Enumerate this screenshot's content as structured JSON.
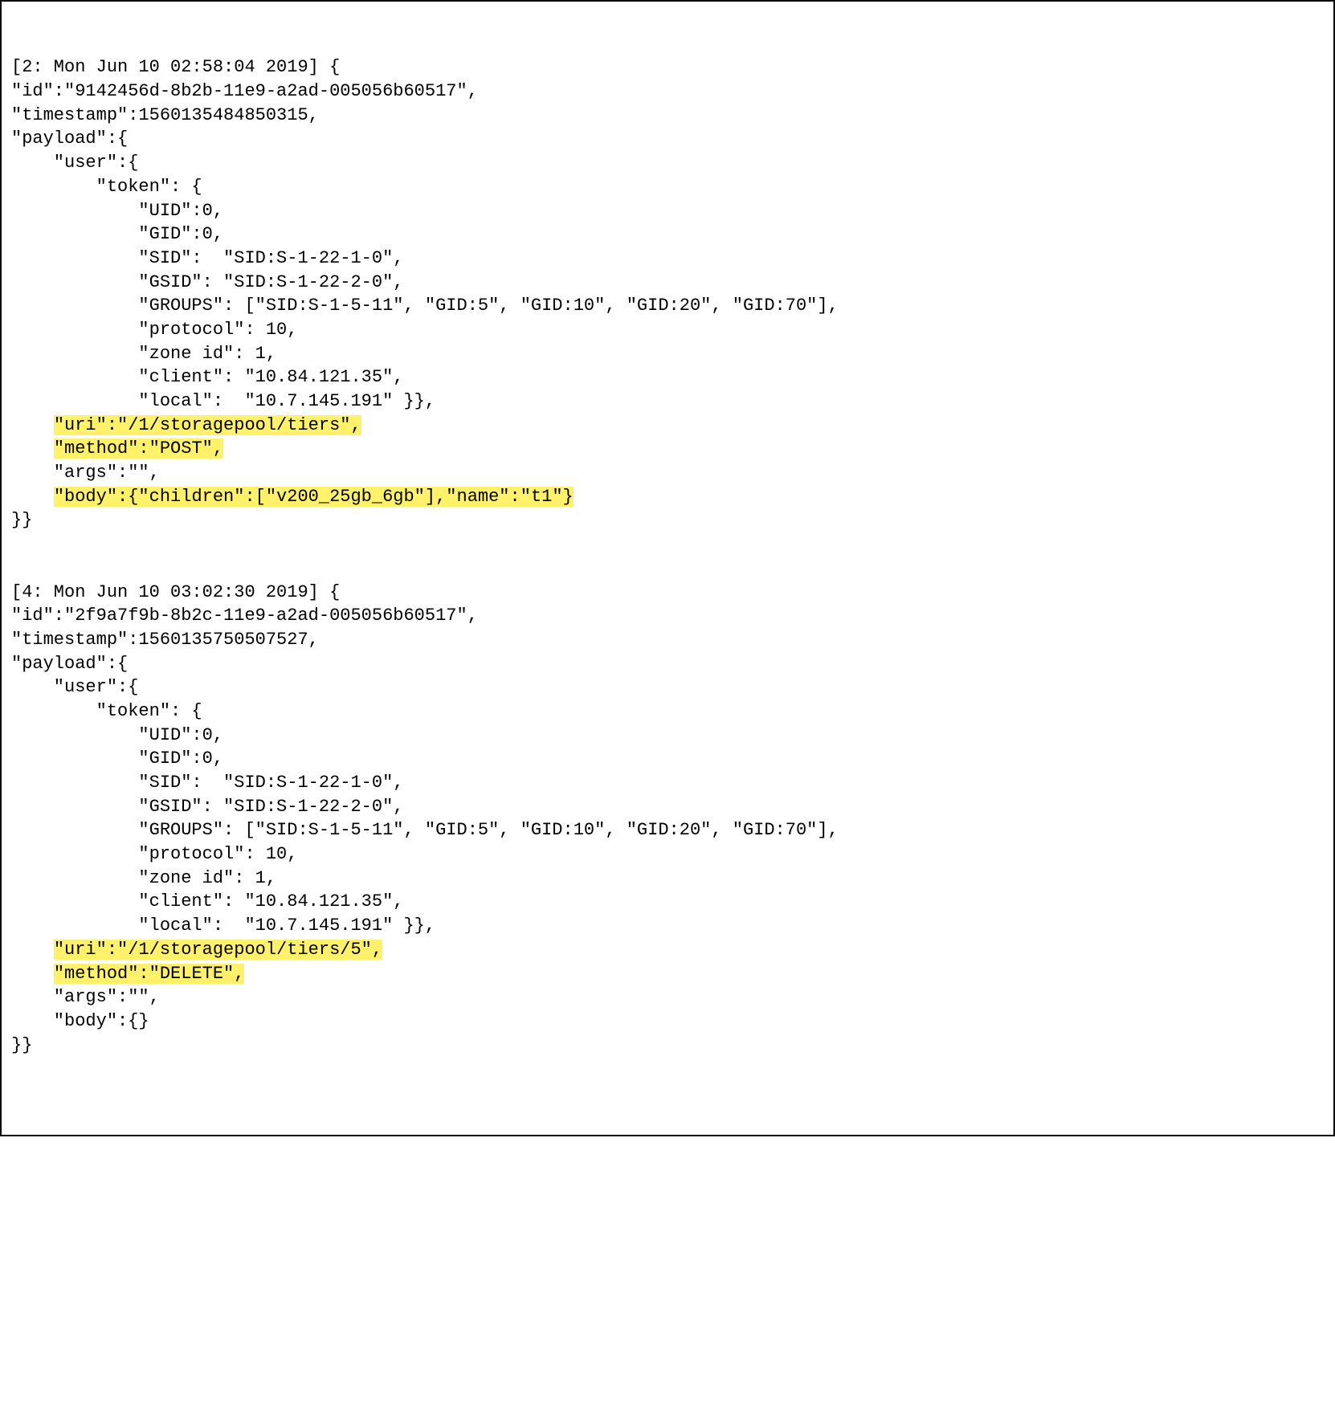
{
  "entries": [
    {
      "header": "[2: Mon Jun 10 02:58:04 2019] {",
      "id_line": "\"id\":\"9142456d-8b2b-11e9-a2ad-005056b60517\",",
      "ts_line": "\"timestamp\":1560135484850315,",
      "payload_line": "\"payload\":{",
      "user_line": "    \"user\":{",
      "token_line": "        \"token\": {",
      "uid_line": "            \"UID\":0,",
      "gid_line": "            \"GID\":0,",
      "sid_line": "            \"SID\":  \"SID:S-1-22-1-0\",",
      "gsid_line": "            \"GSID\": \"SID:S-1-22-2-0\",",
      "groups_line": "            \"GROUPS\": [\"SID:S-1-5-11\", \"GID:5\", \"GID:10\", \"GID:20\", \"GID:70\"],",
      "proto_line": "            \"protocol\": 10,",
      "zone_line": "            \"zone id\": 1,",
      "client_line": "            \"client\": \"10.84.121.35\",",
      "local_line": "            \"local\":  \"10.7.145.191\" }},",
      "uri_line": "\"uri\":\"/1/storagepool/tiers\",",
      "method_line": "\"method\":\"POST\",",
      "args_line": "    \"args\":\"\",",
      "body_line": "\"body\":{\"children\":[\"v200_25gb_6gb\"],\"name\":\"t1\"}",
      "close_line": "}}",
      "uri_hl": true,
      "method_hl": true,
      "body_hl": true
    },
    {
      "header": "[4: Mon Jun 10 03:02:30 2019] {",
      "id_line": "\"id\":\"2f9a7f9b-8b2c-11e9-a2ad-005056b60517\",",
      "ts_line": "\"timestamp\":1560135750507527,",
      "payload_line": "\"payload\":{",
      "user_line": "    \"user\":{",
      "token_line": "        \"token\": {",
      "uid_line": "            \"UID\":0,",
      "gid_line": "            \"GID\":0,",
      "sid_line": "            \"SID\":  \"SID:S-1-22-1-0\",",
      "gsid_line": "            \"GSID\": \"SID:S-1-22-2-0\",",
      "groups_line": "            \"GROUPS\": [\"SID:S-1-5-11\", \"GID:5\", \"GID:10\", \"GID:20\", \"GID:70\"],",
      "proto_line": "            \"protocol\": 10,",
      "zone_line": "            \"zone id\": 1,",
      "client_line": "            \"client\": \"10.84.121.35\",",
      "local_line": "            \"local\":  \"10.7.145.191\" }},",
      "uri_line": "\"uri\":\"/1/storagepool/tiers/5\",",
      "method_line": "\"method\":\"DELETE\",",
      "args_line": "    \"args\":\"\",",
      "body_line": "    \"body\":{}",
      "close_line": "}}",
      "uri_hl": true,
      "method_hl": true,
      "body_hl": false
    }
  ]
}
